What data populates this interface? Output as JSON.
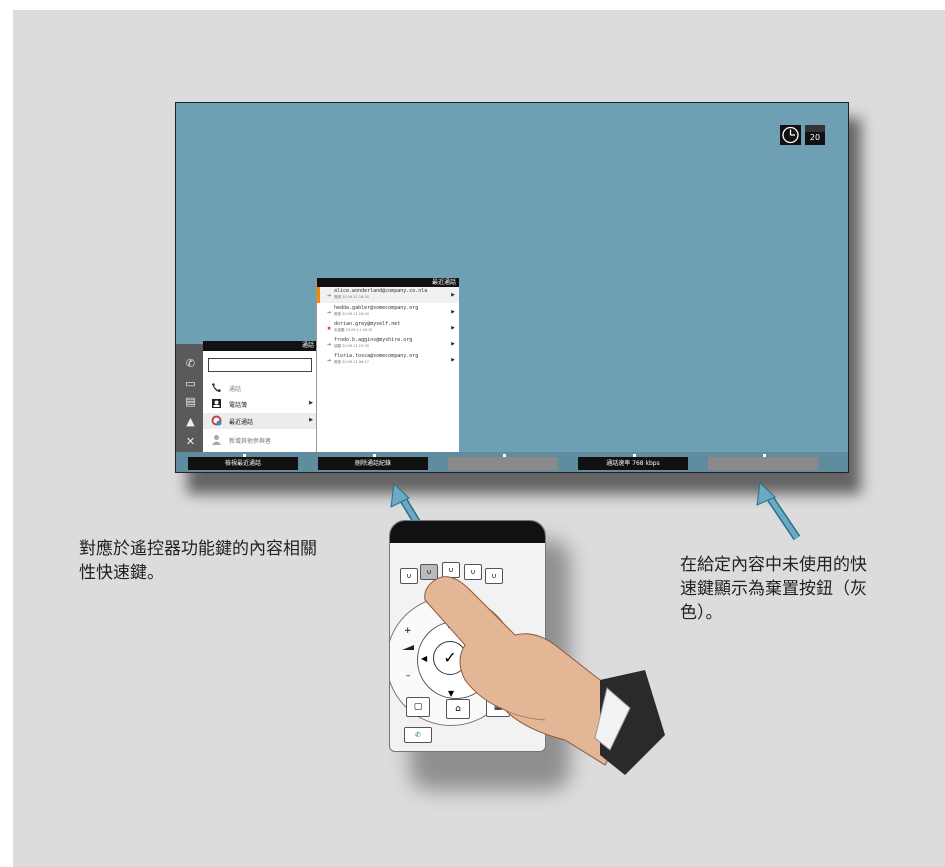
{
  "screen": {
    "calendar_day": "20",
    "call_menu": {
      "title": "通話",
      "items": [
        {
          "label": "通話"
        },
        {
          "label": "電話簿"
        },
        {
          "label": "最近通話"
        },
        {
          "label": "新增其他參與者"
        }
      ]
    },
    "recent_calls": {
      "title": "最近通話",
      "entries": [
        {
          "address": "alice.wonderland@company.co.nla",
          "time": "撥號 20.09.11 16:20"
        },
        {
          "address": "hedda.gabler@somecompany.org",
          "time": "撥號 20.09.11 16:20"
        },
        {
          "address": "dorian.grey@myself.net",
          "time": "未接聽 20.09.11 16:15"
        },
        {
          "address": "frodo.b.aggins@myshire.org",
          "time": "接聽 20.09.11 15:30"
        },
        {
          "address": "floria.tosca@somecompany.org",
          "time": "撥號 20.09.11 08:17"
        }
      ]
    },
    "softkeys": [
      {
        "label": "檢視最近通話",
        "state": "active"
      },
      {
        "label": "刪除通話紀錄",
        "state": "active"
      },
      {
        "label": "",
        "state": "disabled"
      },
      {
        "label": "通話速率 768 kbps",
        "state": "active"
      },
      {
        "label": "",
        "state": "disabled"
      }
    ]
  },
  "captions": {
    "left": [
      "對應於遙控器功能鍵的內容相關",
      "性快速鍵。"
    ],
    "right": [
      "在給定內容中未使用的快",
      "速鍵顯示為棄置按鈕（灰",
      "色）。"
    ]
  },
  "colors": {
    "screen_bg": "#6e9fb2",
    "arrow": "#6aaac4",
    "selected_marker": "#f28a00"
  }
}
